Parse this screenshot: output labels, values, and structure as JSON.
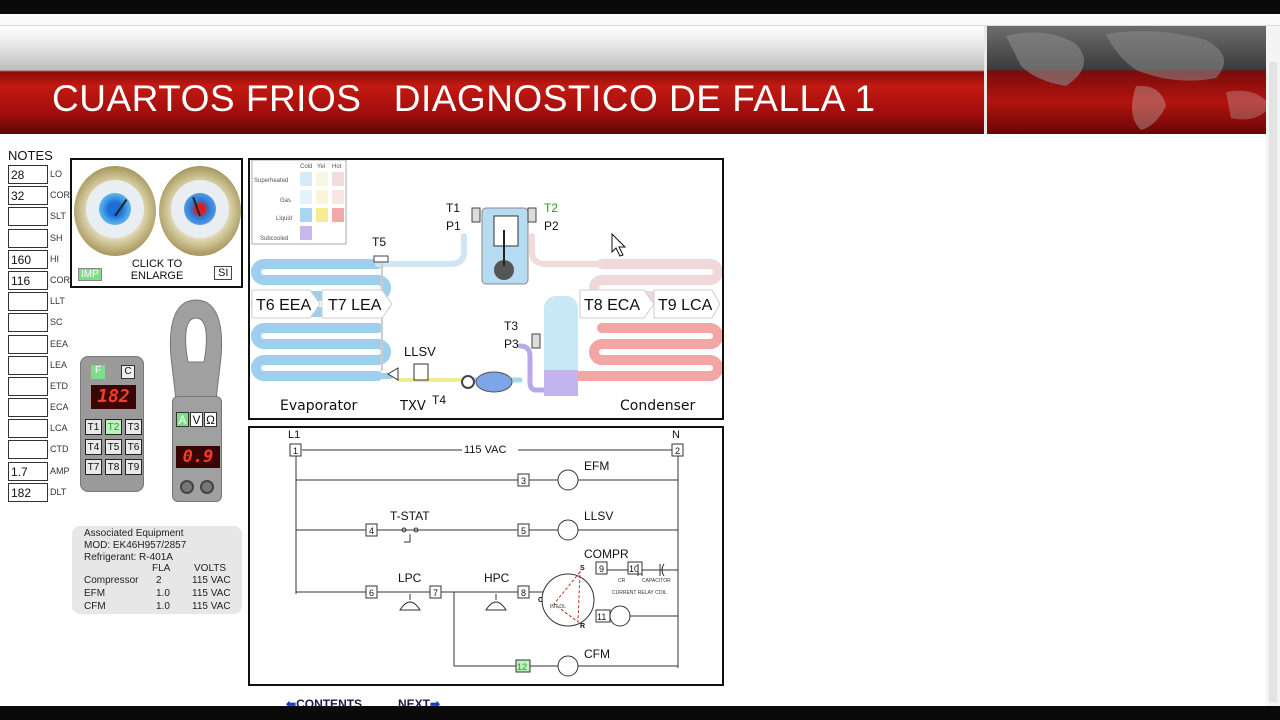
{
  "header": {
    "title": "CUARTOS FRIOS   DIAGNOSTICO DE FALLA 1"
  },
  "notes": {
    "title": "NOTES",
    "rows": [
      {
        "value": "28",
        "label": "LO"
      },
      {
        "value": "32",
        "label": "COR"
      },
      {
        "value": "",
        "label": "SLT"
      },
      {
        "value": "",
        "label": "SH"
      },
      {
        "value": "160",
        "label": "HI"
      },
      {
        "value": "116",
        "label": "COR"
      },
      {
        "value": "",
        "label": "LLT"
      },
      {
        "value": "",
        "label": "SC"
      },
      {
        "value": "",
        "label": "EEA"
      },
      {
        "value": "",
        "label": "LEA"
      },
      {
        "value": "",
        "label": "ETD"
      },
      {
        "value": "",
        "label": "ECA"
      },
      {
        "value": "",
        "label": "LCA"
      },
      {
        "value": "",
        "label": "CTD"
      },
      {
        "value": "1.7",
        "label": "AMP"
      },
      {
        "value": "182",
        "label": "DLT"
      }
    ]
  },
  "gauges": {
    "caption": "CLICK TO ENLARGE",
    "imp": "IMP",
    "si": "SI"
  },
  "thermometer": {
    "unit_f": "F",
    "unit_c": "C",
    "reading": "182",
    "buttons": [
      "T1",
      "T2",
      "T3",
      "T4",
      "T5",
      "T6",
      "T7",
      "T8",
      "T9"
    ],
    "selected": "T2"
  },
  "clamp_meter": {
    "modes": [
      "A",
      "V",
      "Ω"
    ],
    "active_mode": "A",
    "reading": "0.9"
  },
  "associated_equipment": {
    "title": "Associated Equipment",
    "model": "MOD:  EK46H957/2857",
    "refrigerant": "Refrigerant: R-401A",
    "col_fla": "FLA",
    "col_volts": "VOLTS",
    "rows": [
      {
        "name": "Compressor",
        "fla": "2",
        "volts": "115 VAC"
      },
      {
        "name": "EFM",
        "fla": "1.0",
        "volts": "115 VAC"
      },
      {
        "name": "CFM",
        "fla": "1.0",
        "volts": "115 VAC"
      }
    ]
  },
  "refrigeration_diagram": {
    "legend_cols": [
      "Cold",
      "Yel",
      "Hot"
    ],
    "legend_rows": [
      "Superheated",
      "Gas",
      "Liquid",
      "Subcooled"
    ],
    "t1": "T1",
    "p1": "P1",
    "t2": "T2",
    "p2": "P2",
    "t3": "T3",
    "p3": "P3",
    "t4": "T4",
    "t5": "T5",
    "eea": "T6  EEA",
    "lea": "T7  LEA",
    "eca": "T8  ECA",
    "lca": "T9  LCA",
    "llsv": "LLSV",
    "txv": "TXV",
    "evaporator": "Evaporator",
    "condenser": "Condenser"
  },
  "wiring_diagram": {
    "l1": "L1",
    "n": "N",
    "supply": "115 VAC",
    "efm": "EFM",
    "tstat": "T-STAT",
    "llsv": "LLSV",
    "compr": "COMPR",
    "lpc": "LPC",
    "hpc": "HPC",
    "cfm": "CFM",
    "cr": "CR",
    "capacitor": "CAPACITOR",
    "relay": "CURRENT RELAY COIL",
    "int_ol": "INT OL",
    "s": "S",
    "c": "C",
    "r": "R",
    "nodes": [
      "1",
      "2",
      "3",
      "4",
      "5",
      "6",
      "7",
      "8",
      "9",
      "10",
      "11",
      "12"
    ]
  },
  "navigation": {
    "contents": "CONTENTS",
    "next": "NEXT"
  }
}
